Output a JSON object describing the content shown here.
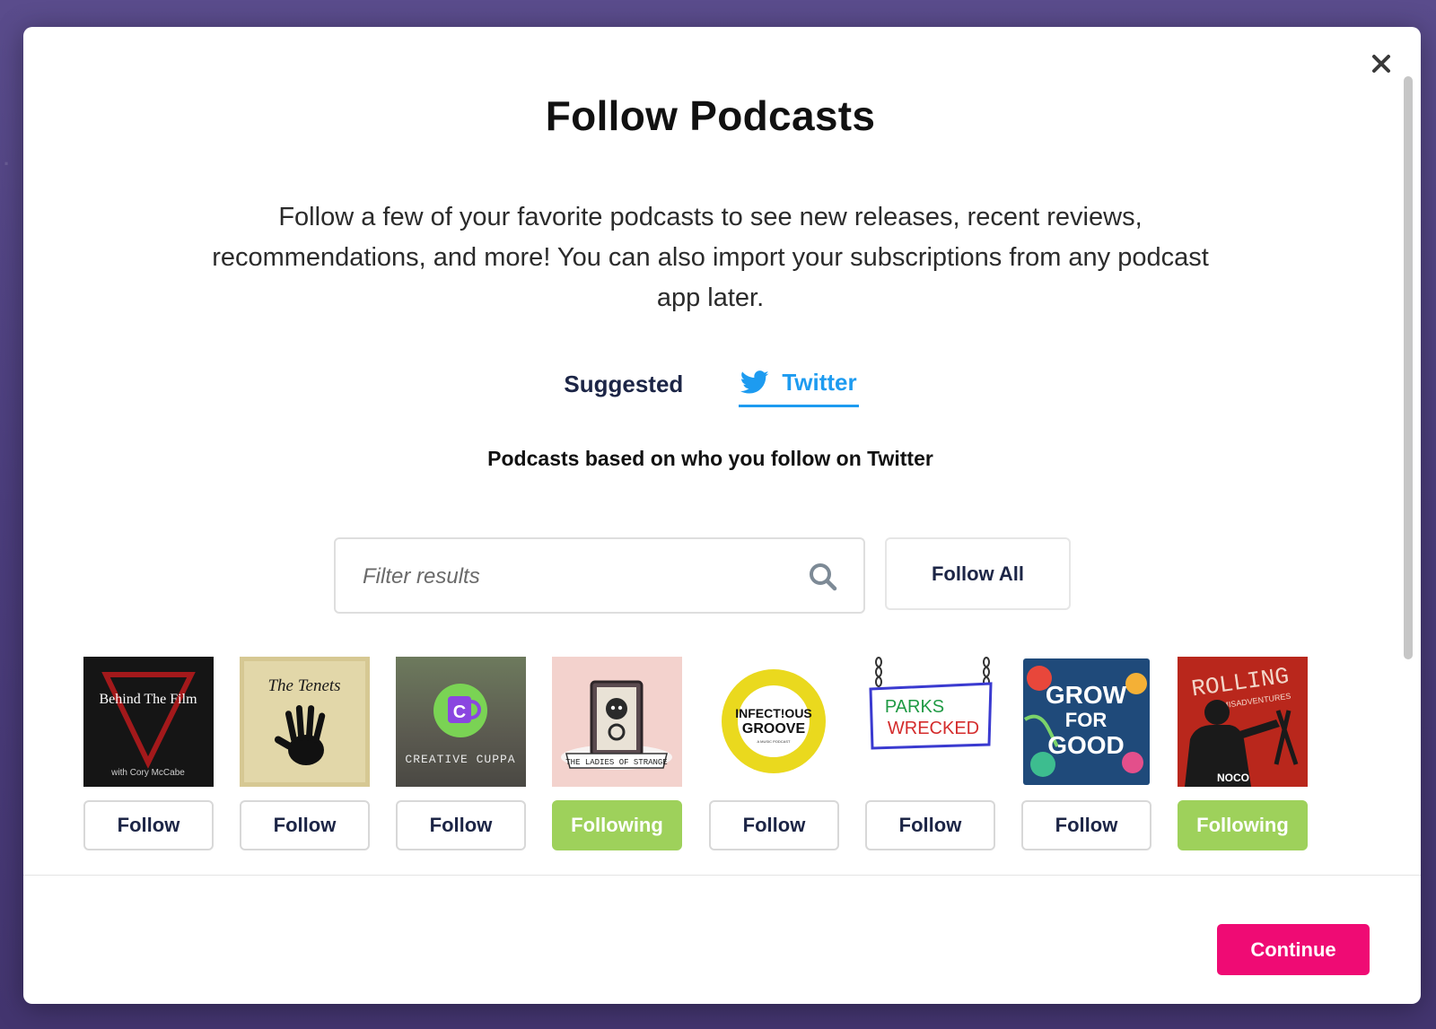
{
  "modal": {
    "title": "Follow Podcasts",
    "description": "Follow a few of your favorite podcasts to see new releases, recent reviews, recommendations, and more! You can also import your subscriptions from any podcast app later."
  },
  "tabs": [
    {
      "label": "Suggested",
      "active": false
    },
    {
      "label": "Twitter",
      "active": true,
      "icon": "twitter-bird-icon"
    }
  ],
  "subtitle": "Podcasts based on who you follow on Twitter",
  "filter": {
    "placeholder": "Filter results",
    "value": ""
  },
  "follow_all_label": "Follow All",
  "podcasts": [
    {
      "cover_title": "Behind The Film",
      "cover_subtitle": "with Cory McCabe",
      "button": "Follow",
      "following": false
    },
    {
      "cover_title": "The Tenets",
      "button": "Follow",
      "following": false
    },
    {
      "cover_title": "CREATIVE CUPPA",
      "cover_mark": "C",
      "button": "Follow",
      "following": false
    },
    {
      "cover_title": "THE LADIES OF STRANGE",
      "button": "Following",
      "following": true
    },
    {
      "cover_title_1": "INFECT!OUS",
      "cover_title_2": "GROOVE",
      "cover_subtitle": "A MUSIC PODCAST",
      "button": "Follow",
      "following": false
    },
    {
      "cover_title_1": "PARKS",
      "cover_title_2": "WRECKED",
      "button": "Follow",
      "following": false
    },
    {
      "cover_title_1": "GROW",
      "cover_title_2": "FOR",
      "cover_title_3": "GOOD",
      "button": "Follow",
      "following": false
    },
    {
      "cover_title": "ROLLING",
      "cover_subtitle": "MISADVENTURES",
      "cover_mark": "NOCO",
      "button": "Following",
      "following": true
    }
  ],
  "continue_label": "Continue",
  "colors": {
    "accent_pink": "#ef0b74",
    "following_green": "#9ed15b",
    "twitter_blue": "#1d9bf0",
    "text_navy": "#1c2546"
  }
}
